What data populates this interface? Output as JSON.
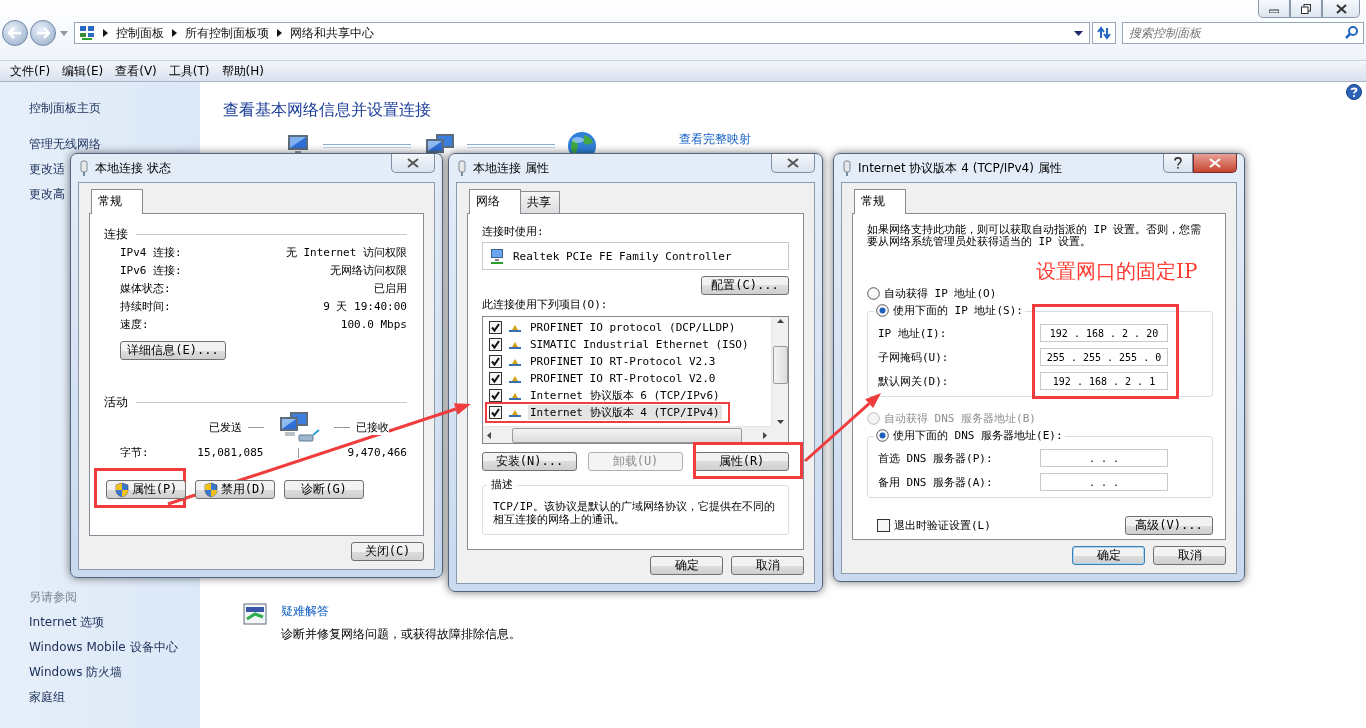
{
  "window": {
    "address_path": [
      "控制面板",
      "所有控制面板项",
      "网络和共享中心"
    ],
    "search": {
      "placeholder": "搜索控制面板"
    }
  },
  "menu": [
    "文件(F)",
    "编辑(E)",
    "查看(V)",
    "工具(T)",
    "帮助(H)"
  ],
  "sidebar": {
    "items": [
      "控制面板主页",
      "管理无线网络",
      "更改适",
      "更改高"
    ],
    "see_also_title": "另请参阅",
    "see_also": [
      "Internet 选项",
      "Windows Mobile 设备中心",
      "Windows 防火墙",
      "家庭组"
    ]
  },
  "main": {
    "title": "查看基本网络信息并设置连接",
    "map_link": "查看完整映射",
    "troubleshoot": {
      "link": "疑难解答",
      "description": "诊断并修复网络问题，或获得故障排除信息。"
    }
  },
  "status_dialog": {
    "title": "本地连接 状态",
    "tabs": [
      {
        "label": "常规",
        "selected": true
      }
    ],
    "connection_heading": "连接",
    "rows": [
      {
        "label": "IPv4 连接:",
        "value": "无 Internet 访问权限"
      },
      {
        "label": "IPv6 连接:",
        "value": "无网络访问权限"
      },
      {
        "label": "媒体状态:",
        "value": "已启用"
      },
      {
        "label": "持续时间:",
        "value": "9 天 19:40:00"
      },
      {
        "label": "速度:",
        "value": "100.0 Mbps"
      }
    ],
    "details_button": "详细信息(E)...",
    "activity_heading": "活动",
    "sent_label": "已发送",
    "received_label": "已接收",
    "bytes_label": "字节:",
    "bytes_sent": "15,081,085",
    "bytes_received": "9,470,466",
    "buttons": [
      {
        "label": "属性(P)",
        "shield": true
      },
      {
        "label": "禁用(D)",
        "shield": true
      },
      {
        "label": "诊断(G)",
        "shield": false
      }
    ],
    "close_button": "关闭(C)"
  },
  "properties_dialog": {
    "title": "本地连接 属性",
    "tabs": [
      {
        "label": "网络",
        "selected": true
      },
      {
        "label": "共享",
        "selected": false
      }
    ],
    "connect_using_label": "连接时使用:",
    "adapter": "Realtek PCIe FE Family Controller",
    "configure_button": "配置(C)...",
    "items_label": "此连接使用下列项目(O):",
    "items": [
      {
        "label": "PROFINET IO protocol (DCP/LLDP)",
        "checked": true,
        "selected": false
      },
      {
        "label": "SIMATIC Industrial Ethernet (ISO)",
        "checked": true,
        "selected": false
      },
      {
        "label": "PROFINET IO RT-Protocol V2.3",
        "checked": true,
        "selected": false
      },
      {
        "label": "PROFINET IO RT-Protocol V2.0",
        "checked": true,
        "selected": false
      },
      {
        "label": "Internet 协议版本 6 (TCP/IPv6)",
        "checked": true,
        "selected": false
      },
      {
        "label": "Internet 协议版本 4 (TCP/IPv4)",
        "checked": true,
        "selected": true
      }
    ],
    "buttons": [
      {
        "label": "安装(N)...",
        "disabled": false
      },
      {
        "label": "卸载(U)",
        "disabled": true
      },
      {
        "label": "属性(R)",
        "disabled": false
      }
    ],
    "description_label": "描述",
    "description": "TCP/IP。该协议是默认的广域网络协议，它提供在不同的相互连接的网络上的通讯。",
    "footer_buttons": [
      "确定",
      "取消"
    ]
  },
  "ipv4_dialog": {
    "title": "Internet 协议版本 4 (TCP/IPv4) 属性",
    "tabs": [
      {
        "label": "常规",
        "selected": true
      }
    ],
    "intro": "如果网络支持此功能，则可以获取自动指派的 IP 设置。否则，您需要从网络系统管理员处获得适当的 IP 设置。",
    "ip_modes": [
      {
        "label": "自动获得 IP 地址(O)",
        "selected": false,
        "disabled": false
      },
      {
        "label": "使用下面的 IP 地址(S):",
        "selected": true,
        "disabled": false
      }
    ],
    "ip_fields": [
      {
        "label": "IP 地址(I):",
        "value": "192 . 168 . 2 . 20"
      },
      {
        "label": "子网掩码(U):",
        "value": "255 . 255 . 255 . 0"
      },
      {
        "label": "默认网关(D):",
        "value": "192 . 168 . 2 . 1"
      }
    ],
    "dns_modes": [
      {
        "label": "自动获得 DNS 服务器地址(B)",
        "selected": false,
        "disabled": true
      },
      {
        "label": "使用下面的 DNS 服务器地址(E):",
        "selected": true,
        "disabled": false
      }
    ],
    "dns_fields": [
      {
        "label": "首选 DNS 服务器(P):",
        "value": ". . ."
      },
      {
        "label": "备用 DNS 服务器(A):",
        "value": ". . ."
      }
    ],
    "validate_checkbox": {
      "label": "退出时验证设置(L)",
      "checked": false
    },
    "advanced_button": "高级(V)...",
    "footer_buttons": [
      {
        "label": "确定",
        "default": true
      },
      {
        "label": "取消",
        "default": false
      }
    ]
  },
  "annotation": {
    "note": "设置网口的固定IP"
  }
}
